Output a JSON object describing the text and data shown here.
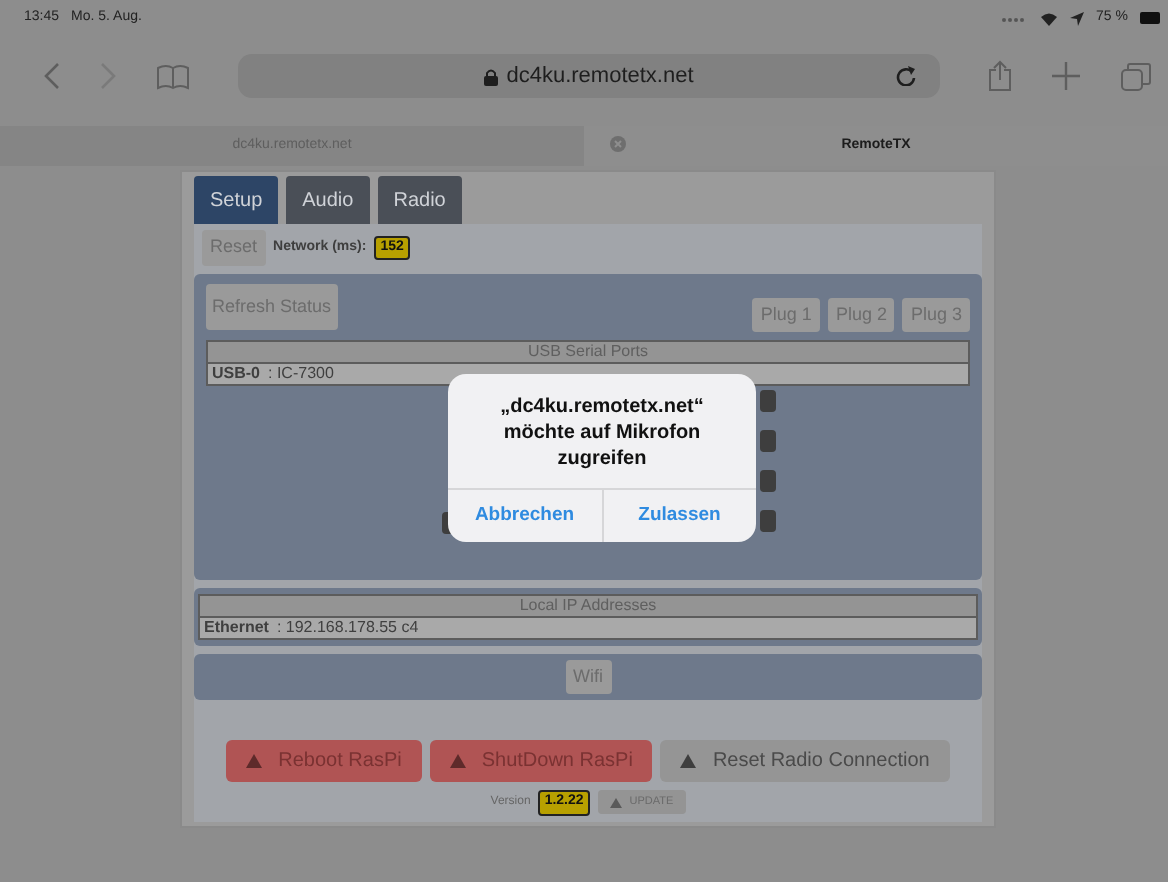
{
  "status_bar": {
    "time": "13:45",
    "date": "Mo. 5. Aug.",
    "battery": "75 %"
  },
  "browser": {
    "url": "dc4ku.remotetx.net",
    "tabs": [
      {
        "label": "dc4ku.remotetx.net",
        "selected": false
      },
      {
        "label": "RemoteTX",
        "selected": true
      }
    ]
  },
  "app_tabs": [
    {
      "label": "Setup",
      "selected": true
    },
    {
      "label": "Audio",
      "selected": false
    },
    {
      "label": "Radio",
      "selected": false
    }
  ],
  "reset_button": "Reset",
  "network_label": "Network (ms):",
  "network_value": "152",
  "refresh_button": "Refresh Status",
  "plugs": [
    "Plug 1",
    "Plug 2",
    "Plug 3"
  ],
  "usb_table": {
    "heading": "USB Serial Ports",
    "rows": [
      {
        "name": "USB-0",
        "value": ": IC-7300"
      }
    ]
  },
  "ip_table": {
    "heading": "Local IP Addresses",
    "rows": [
      {
        "name": "Ethernet",
        "value": ": 192.168.178.55 c4"
      }
    ]
  },
  "wifi_button": "Wifi",
  "actions": [
    {
      "label": "Reboot RasPi",
      "kind": "danger"
    },
    {
      "label": "ShutDown RasPi",
      "kind": "danger"
    },
    {
      "label": "Reset Radio Connection",
      "kind": "secondary"
    }
  ],
  "version": {
    "label": "Version",
    "value": "1.2.22",
    "update": "UPDATE"
  },
  "dialog": {
    "message": "„dc4ku.remotetx.net“ möchte auf Mikrofon zugreifen",
    "buttons": [
      "Abbrechen",
      "Zulassen"
    ]
  }
}
